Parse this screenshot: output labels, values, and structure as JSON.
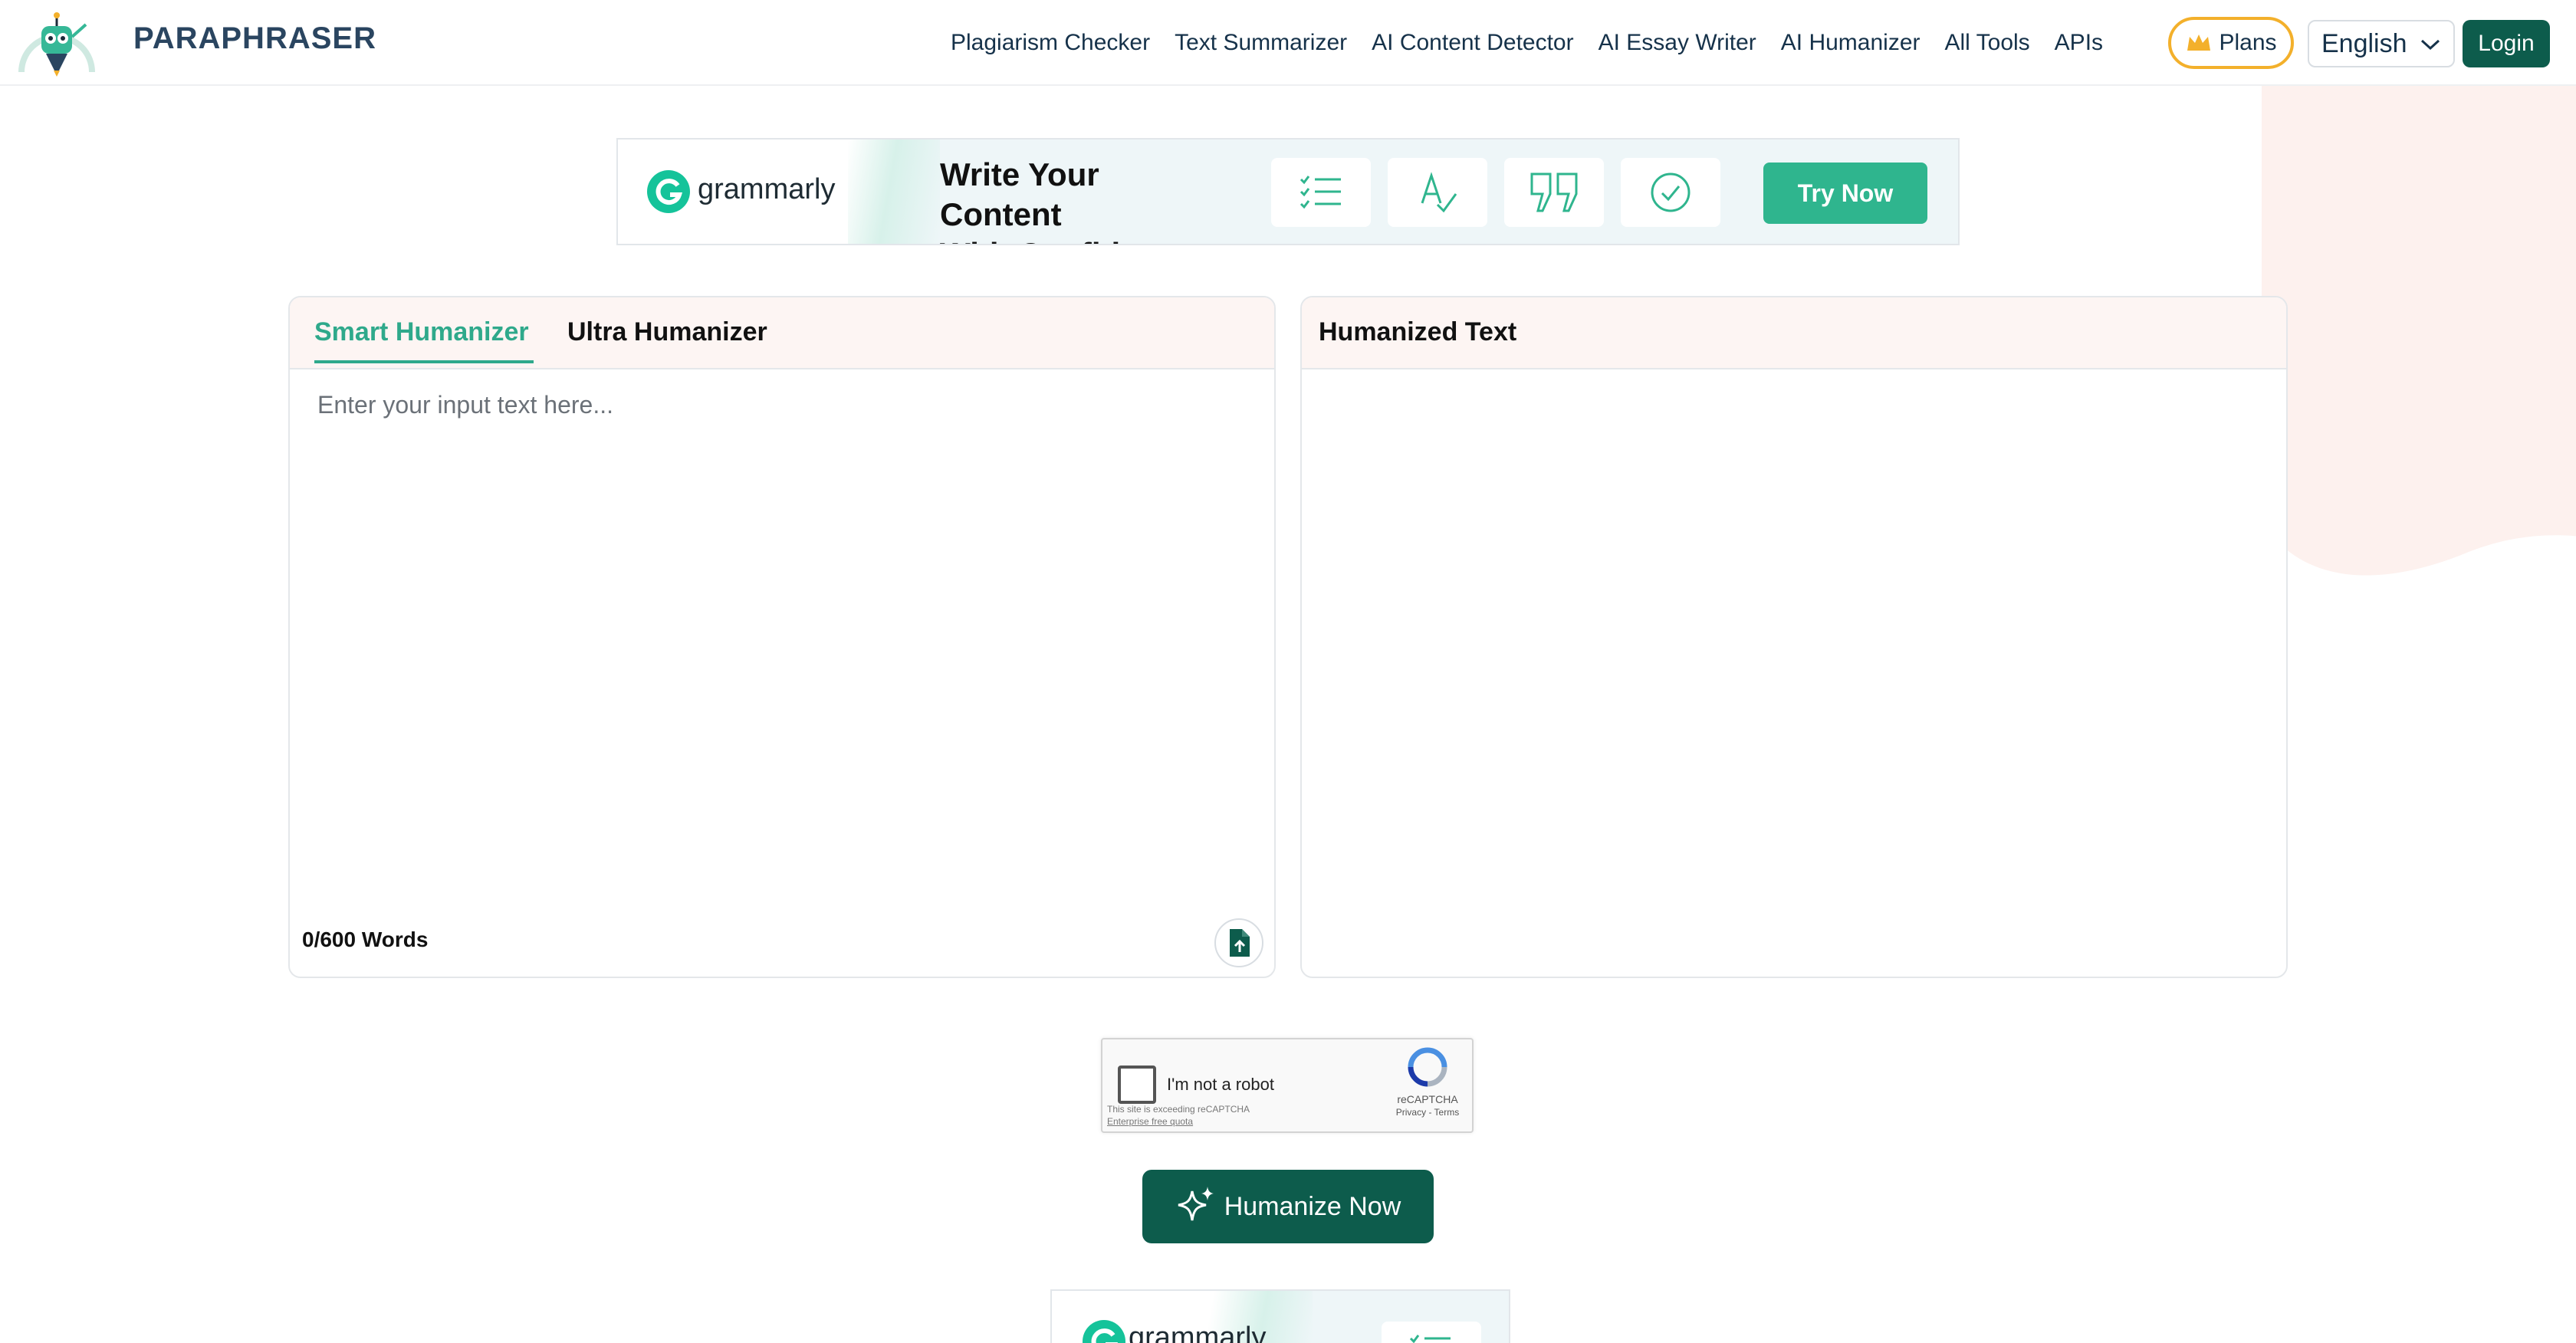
{
  "header": {
    "brand": "PARAPHRASER",
    "nav": [
      "Plagiarism Checker",
      "Text Summarizer",
      "AI Content Detector",
      "AI Essay Writer",
      "AI Humanizer",
      "All Tools",
      "APIs"
    ],
    "plans_label": "Plans",
    "language": "English",
    "login_label": "Login"
  },
  "ad": {
    "brand": "grammarly",
    "headline_line1": "Write Your Content",
    "headline_line2": "With Confidence",
    "cta": "Try Now"
  },
  "input_panel": {
    "tab_active": "Smart Humanizer",
    "tab_other": "Ultra Humanizer",
    "placeholder": "Enter your input text here...",
    "word_count": "0/600 Words"
  },
  "output_panel": {
    "title": "Humanized Text"
  },
  "captcha": {
    "label": "I'm not a robot",
    "note_line1": "This site is exceeding reCAPTCHA",
    "note_line2": "Enterprise free quota",
    "brand": "reCAPTCHA",
    "links": "Privacy - Terms"
  },
  "action": {
    "humanize_label": "Humanize Now"
  },
  "bottom_ad": {
    "brand": "grammarly"
  },
  "colors": {
    "primary": "#0d5c4c",
    "accent": "#2fa98b",
    "plans_border": "#f3b02b",
    "panel_header_bg": "#fdf5f3"
  },
  "icons": [
    "robot-mascot-logo",
    "crown-icon",
    "chevron-down-icon",
    "grammarly-g-icon",
    "checklist-icon",
    "spell-check-icon",
    "quote-icon",
    "check-circle-icon",
    "file-upload-icon",
    "recaptcha-icon",
    "sparkle-icon"
  ]
}
